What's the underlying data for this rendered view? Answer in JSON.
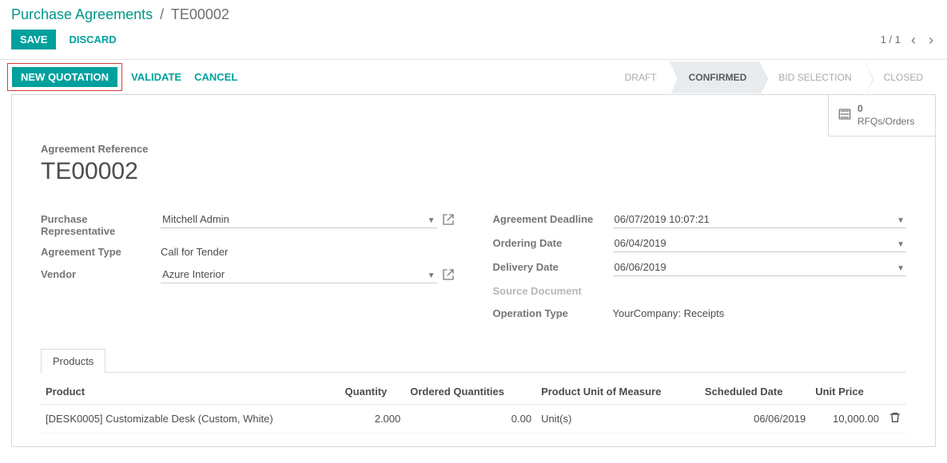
{
  "breadcrumb": {
    "link": "Purchase Agreements",
    "current": "TE00002"
  },
  "controls": {
    "save": "SAVE",
    "discard": "DISCARD",
    "pager": "1 / 1"
  },
  "actions": {
    "new_quotation": "NEW QUOTATION",
    "validate": "VALIDATE",
    "cancel": "CANCEL"
  },
  "status": {
    "draft": "DRAFT",
    "confirmed": "CONFIRMED",
    "bid": "BID SELECTION",
    "closed": "CLOSED"
  },
  "stat_button": {
    "count": "0",
    "label": "RFQs/Orders"
  },
  "header": {
    "label": "Agreement Reference",
    "value": "TE00002"
  },
  "fields": {
    "purchase_rep_label": "Purchase Representative",
    "purchase_rep_value": "Mitchell Admin",
    "agreement_type_label": "Agreement Type",
    "agreement_type_value": "Call for Tender",
    "vendor_label": "Vendor",
    "vendor_value": "Azure Interior",
    "deadline_label": "Agreement Deadline",
    "deadline_value": "06/07/2019 10:07:21",
    "ordering_label": "Ordering Date",
    "ordering_value": "06/04/2019",
    "delivery_label": "Delivery Date",
    "delivery_value": "06/06/2019",
    "source_label": "Source Document",
    "op_type_label": "Operation Type",
    "op_type_value": "YourCompany: Receipts"
  },
  "tab": {
    "products": "Products"
  },
  "table": {
    "h_product": "Product",
    "h_qty": "Quantity",
    "h_ordered": "Ordered Quantities",
    "h_uom": "Product Unit of Measure",
    "h_sched": "Scheduled Date",
    "h_price": "Unit Price",
    "r1_product": "[DESK0005] Customizable Desk (Custom, White)",
    "r1_qty": "2.000",
    "r1_ordered": "0.00",
    "r1_uom": "Unit(s)",
    "r1_sched": "06/06/2019",
    "r1_price": "10,000.00"
  }
}
